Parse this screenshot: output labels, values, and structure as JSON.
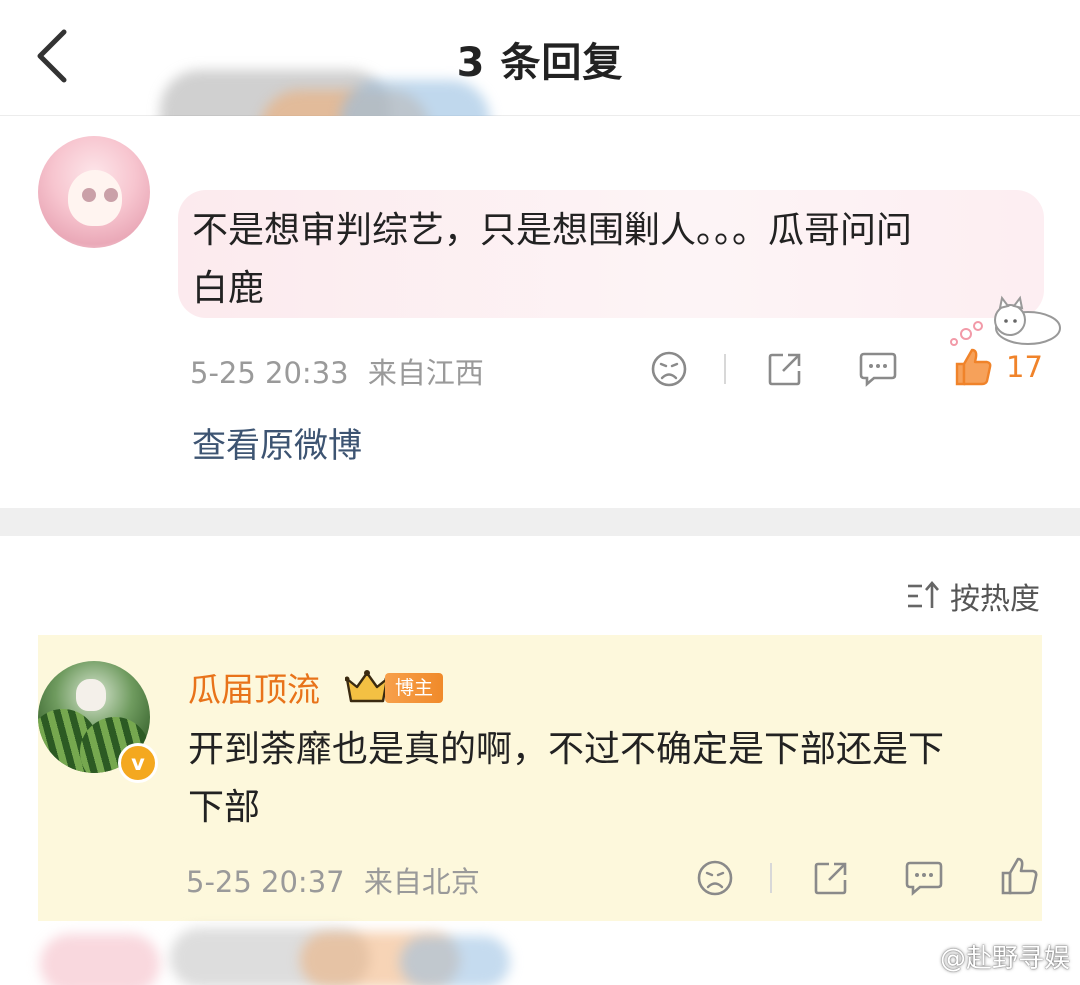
{
  "header": {
    "title": "3 条回复",
    "back_icon": "chevron-left-icon"
  },
  "original_comment": {
    "text_line1": "不是想审判综艺，只是想围剿人。。。瓜哥问问",
    "text_line2": "白鹿",
    "timestamp": "5-25 20:33",
    "location": "来自江西",
    "like_count": "17",
    "view_original_label": "查看原微博",
    "actions": [
      "dislike-icon",
      "share-icon",
      "comment-icon",
      "like-icon"
    ],
    "like_active_color": "#f0832a"
  },
  "replies": {
    "sort_label": "按热度",
    "sort_icon": "sort-icon",
    "items": [
      {
        "name": "瓜届顶流",
        "badge_label": "博主",
        "verified_glyph": "v",
        "text_line1": "开到荼靡也是真的啊，不过不确定是下部还是下",
        "text_line2": "下部",
        "timestamp": "5-25 20:37",
        "location": "来自北京",
        "name_color": "#e8731a",
        "card_bg": "#fdf8dc"
      }
    ]
  },
  "watermark": {
    "text": "@赴野寻娱",
    "icon": "weibo-logo-icon"
  }
}
